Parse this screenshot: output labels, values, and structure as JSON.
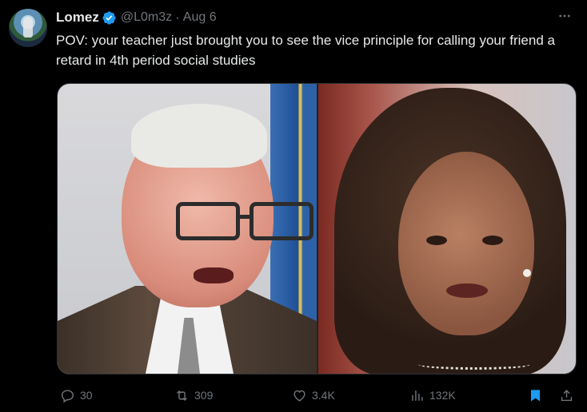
{
  "tweet": {
    "author_name": "Lomez",
    "handle": "@L0m3z",
    "separator": "·",
    "date": "Aug 6",
    "text": "POV: your teacher just brought you to see the vice principle for calling your friend a retard in 4th period social studies",
    "media": [
      {
        "kind": "photo",
        "icon": "photo-left"
      },
      {
        "kind": "photo",
        "icon": "photo-right"
      }
    ]
  },
  "metrics": {
    "replies": "30",
    "reposts": "309",
    "likes": "3.4K",
    "views": "132K"
  },
  "colors": {
    "background": "#000000",
    "text": "#e7e9ea",
    "muted": "#71767b",
    "accent": "#1d9bf0"
  },
  "icons": {
    "verified": "verified-badge-icon",
    "more": "more-dots-icon",
    "reply": "reply-icon",
    "repost": "repost-icon",
    "like": "heart-icon",
    "views": "views-icon",
    "bookmark": "bookmark-icon",
    "share": "share-icon"
  }
}
